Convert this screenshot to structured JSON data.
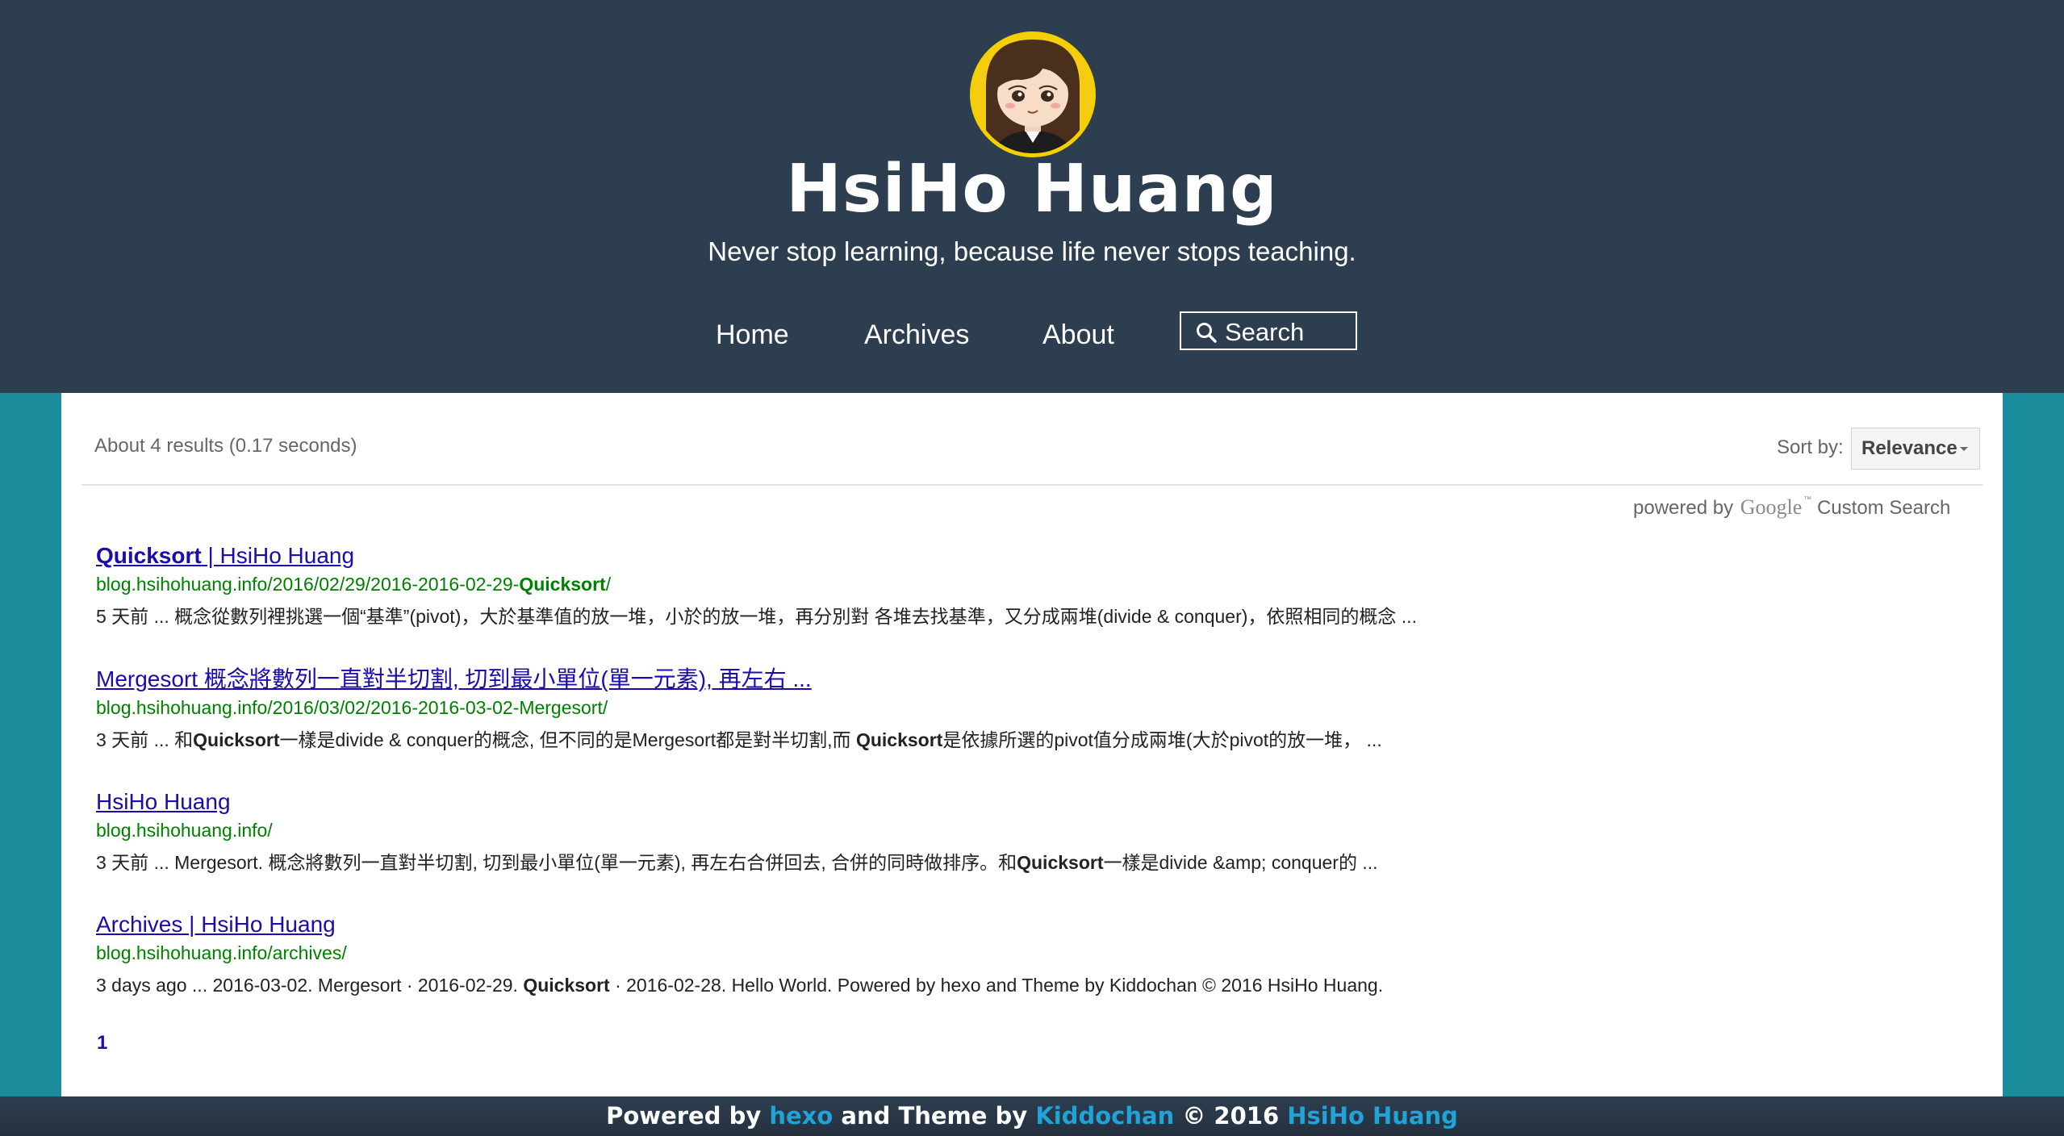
{
  "header": {
    "site_title": "HsiHo Huang",
    "tagline": "Never stop learning, because life never stops teaching.",
    "nav": {
      "home": "Home",
      "archives": "Archives",
      "about": "About",
      "search": "Search"
    }
  },
  "results": {
    "info": "About 4 results (0.17 seconds)",
    "sort_label": "Sort by:",
    "sort_value": "Relevance",
    "powered_by": "powered by",
    "google": "Google",
    "custom_search": "Custom Search",
    "items": [
      {
        "title_bold": "Quicksort",
        "title_rest": " | HsiHo Huang",
        "url_pre": "blog.hsihohuang.info/2016/02/29/2016-2016-02-29-",
        "url_bold": "Quicksort",
        "url_post": "/",
        "snippet": "5 天前 ... 概念從數列裡挑選一個“基準”(pivot)，大於基準值的放一堆，小於的放一堆，再分別對 各堆去找基準，又分成兩堆(divide & conquer)，依照相同的概念 ..."
      },
      {
        "title": "Mergesort 概念將數列一直對半切割, 切到最小單位(單一元素), 再左右 ...",
        "url": "blog.hsihohuang.info/2016/03/02/2016-2016-03-02-Mergesort/",
        "snippet_a": "3 天前 ... 和",
        "snippet_b": "Quicksort",
        "snippet_c": "一樣是divide & conquer的概念, 但不同的是Mergesort都是對半切割,而 ",
        "snippet_d": "Quicksort",
        "snippet_e": "是依據所選的pivot值分成兩堆(大於pivot的放一堆， ..."
      },
      {
        "title": "HsiHo Huang",
        "url": "blog.hsihohuang.info/",
        "snippet_a": "3 天前 ... Mergesort. 概念將數列一直對半切割, 切到最小單位(單一元素), 再左右合併回去, 合併的同時做排序。和",
        "snippet_b": "Quicksort",
        "snippet_c": "一樣是divide &amp; conquer的 ..."
      },
      {
        "title": "Archives | HsiHo Huang",
        "url": "blog.hsihohuang.info/archives/",
        "snippet_a": "3 days ago ... 2016-03-02. Mergesort · 2016-02-29. ",
        "snippet_b": "Quicksort",
        "snippet_c": " · 2016-02-28. Hello World. Powered by hexo and Theme by Kiddochan © 2016 HsiHo Huang."
      }
    ],
    "page": "1"
  },
  "footer": {
    "powered_by": "Powered by ",
    "hexo": "hexo",
    "theme_by": " and Theme by ",
    "kiddochan": "Kiddochan",
    "copyright": " © 2016 ",
    "owner": "HsiHo Huang"
  },
  "colors": {
    "header_bg": "#2d3e50",
    "page_bg": "#1b8c9c",
    "link": "#1a0dab",
    "url": "#008000",
    "footer_link": "#1fa3d8"
  }
}
